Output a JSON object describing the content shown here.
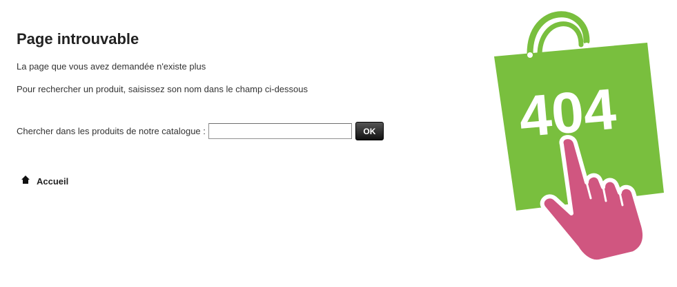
{
  "page": {
    "title": "Page introuvable",
    "message_not_found": "La page que vous avez demandée n'existe plus",
    "message_search_hint": "Pour rechercher un produit, saisissez son nom dans le champ ci-dessous"
  },
  "search": {
    "label": "Chercher dans les produits de notre catalogue :",
    "value": "",
    "placeholder": "",
    "button_label": "OK"
  },
  "home": {
    "label": "Accueil",
    "icon": "home-icon"
  },
  "illustration": {
    "code_text": "404",
    "bag_color": "#79bf3e",
    "hand_color": "#d05680",
    "icons": [
      "shopping-bag-icon",
      "pointing-hand-icon"
    ]
  }
}
